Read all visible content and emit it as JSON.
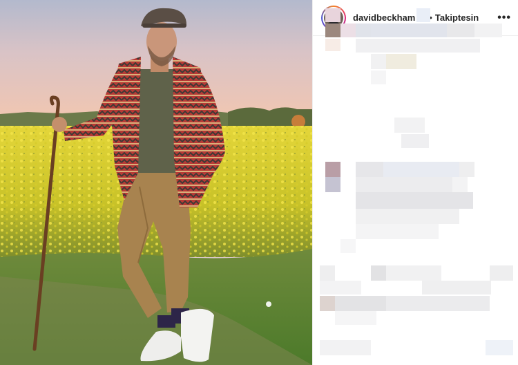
{
  "post": {
    "username": "davidbeckham",
    "verified_icon": "verified-check-icon",
    "follow_status": "Takiptesin",
    "separator": "•",
    "more_icon": "more-options-icon",
    "more_label": "•••"
  },
  "colors": {
    "verified": "#3897f0",
    "text": "#262626",
    "divider": "#efefef"
  }
}
